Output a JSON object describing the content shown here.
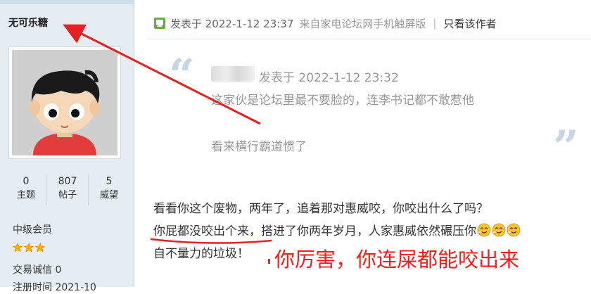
{
  "sidebar": {
    "username": "无可乐糖",
    "stats": [
      {
        "value": "0",
        "label": "主题"
      },
      {
        "value": "807",
        "label": "帖子"
      },
      {
        "value": "5",
        "label": "威望"
      }
    ],
    "group": "中级会员",
    "star_count": 3,
    "credit_label": "交易诚信",
    "credit_value": "0",
    "reg_time": "注册时间 2021-10"
  },
  "post_header": {
    "posted_at": "发表于 2022-1-12 23:37",
    "source": "来自家电论坛网手机触屏版",
    "separator": "|",
    "only_author": "只看该作者"
  },
  "quote": {
    "meta": "发表于 2022-1-12 23:32",
    "line1": "这家伙是论坛里最不要脸的，连李书记都不敢惹他",
    "line2": "看来横行霸道惯了"
  },
  "body": {
    "line1": "看看你这个废物，两年了，追着那对惠威咬，你咬出什么了吗？",
    "line2_underlined": "你屁都没咬出个来",
    "line2_rest": "，搭进了你两年岁月，人家惠威依然碾压你",
    "line3": "自不量力的垃圾！"
  },
  "annotation": {
    "text": "你厉害，你连屎都能咬出来",
    "color": "#ff1a1a"
  },
  "icons": {
    "post": "post-icon",
    "emoji": "shy-smile-emoji-icon",
    "star": "star-icon"
  }
}
